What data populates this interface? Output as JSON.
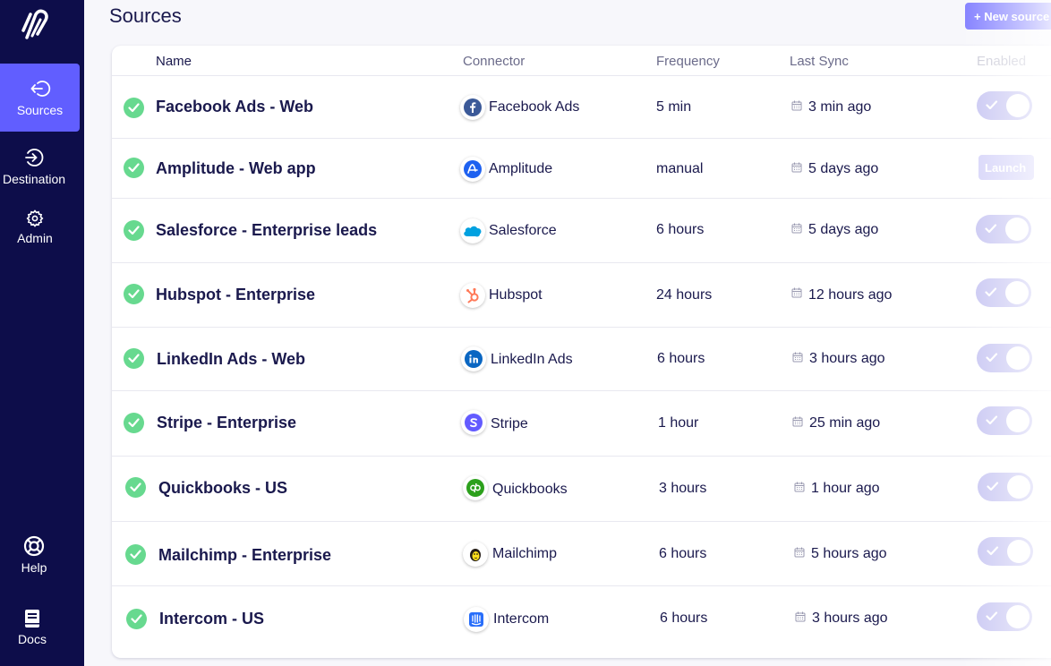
{
  "sidebar": {
    "items": [
      {
        "label": "Sources",
        "icon": "sources-icon"
      },
      {
        "label": "Destination",
        "icon": "destination-icon"
      },
      {
        "label": "Admin",
        "icon": "gear-icon"
      },
      {
        "label": "Help",
        "icon": "lifebuoy-icon"
      },
      {
        "label": "Docs",
        "icon": "book-icon"
      }
    ],
    "active": "Sources",
    "background": "#0d0d4a",
    "active_color": "#615eff"
  },
  "header": {
    "title": "Sources",
    "new_button": "+ New source"
  },
  "table": {
    "columns": [
      "Name",
      "Connector",
      "Frequency",
      "Last Sync",
      "Enabled"
    ],
    "rows": [
      {
        "name": "Facebook Ads - Web",
        "connector": "Facebook Ads",
        "frequency": "5 min",
        "last_sync": "3 min ago",
        "status": "success",
        "enabled": true
      },
      {
        "name": "Amplitude - Web app",
        "connector": "Amplitude",
        "frequency": "manual",
        "last_sync": "5 days ago",
        "status": "success",
        "action": "Launch"
      },
      {
        "name": "Salesforce - Enterprise leads",
        "connector": "Salesforce",
        "frequency": "6 hours",
        "last_sync": "5 days ago",
        "status": "success",
        "enabled": true
      },
      {
        "name": "Hubspot - Enterprise",
        "connector": "Hubspot",
        "frequency": "24 hours",
        "last_sync": "12 hours ago",
        "status": "success",
        "enabled": true
      },
      {
        "name": "LinkedIn Ads - Web",
        "connector": "LinkedIn Ads",
        "frequency": "6 hours",
        "last_sync": "3 hours ago",
        "status": "success",
        "enabled": true
      },
      {
        "name": "Stripe - Enterprise",
        "connector": "Stripe",
        "frequency": "1 hour",
        "last_sync": "25 min ago",
        "status": "success",
        "enabled": true
      },
      {
        "name": "Quickbooks - US",
        "connector": "Quickbooks",
        "frequency": "3 hours",
        "last_sync": "1 hour ago",
        "status": "success",
        "enabled": true
      },
      {
        "name": "Mailchimp - Enterprise",
        "connector": "Mailchimp",
        "frequency": "6 hours",
        "last_sync": "5 hours ago",
        "status": "success",
        "enabled": true
      },
      {
        "name": "Intercom - US",
        "connector": "Intercom",
        "frequency": "6 hours",
        "last_sync": "3 hours ago",
        "status": "success",
        "enabled": true
      }
    ]
  },
  "colors": {
    "status_success": "#67d98f",
    "toggle_on": "#c6c4f2",
    "text_primary": "#1a194d"
  }
}
